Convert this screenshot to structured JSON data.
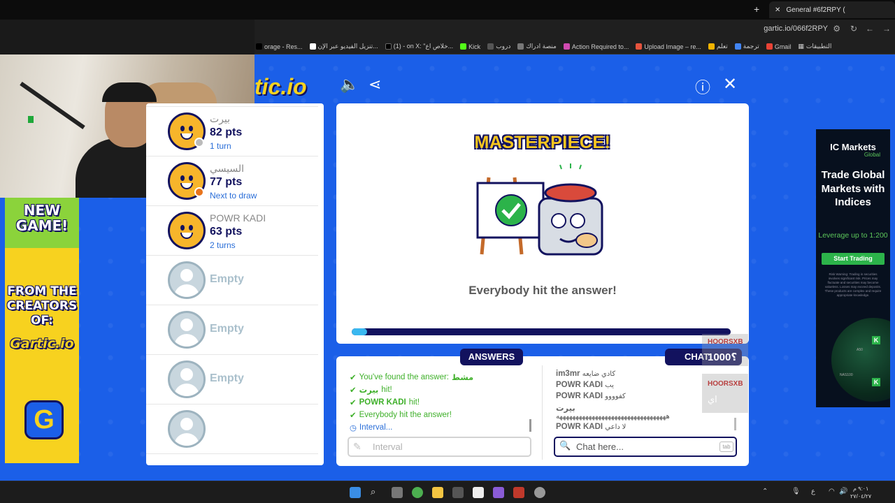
{
  "browser": {
    "tab_title": "General #6f2RPY (",
    "url": "gartic.io/066f2RPY",
    "bookmarks": [
      {
        "label": "Gmail",
        "color": "#ea4335"
      },
      {
        "label": "ترجمة",
        "color": "#4285f4"
      },
      {
        "label": "تعلم",
        "color": "#f4b400"
      },
      {
        "label": "Upload Image – re...",
        "color": "#e5533d"
      },
      {
        "label": "Action Required to...",
        "color": "#d04ab0"
      },
      {
        "label": "منصة ادراك",
        "color": "#777777"
      },
      {
        "label": "دروب",
        "color": "#555555"
      },
      {
        "label": "Kick",
        "color": "#53fc18"
      },
      {
        "label": "(1) - on X: \"خلاص اع...",
        "color": "#000000"
      },
      {
        "label": "تنزيل الفيديو عبر الإن...",
        "color": "#ffffff"
      },
      {
        "label": "orage - Res...",
        "color": "#000000"
      }
    ],
    "apps_label": "التطبيقات"
  },
  "left_ad": {
    "line1": "NEW",
    "line2": "GAME!",
    "line3": "FROM THE",
    "line4": "CREATORS",
    "line5": "OF:",
    "logo": "Gartic.io",
    "g": "G"
  },
  "logo_text": "tic.io",
  "players": [
    {
      "name": "بيرت",
      "points": "82 pts",
      "status": "1 turn",
      "badge_color": "#bbbbbb"
    },
    {
      "name": "السيسي",
      "points": "77 pts",
      "status": "Next to draw",
      "badge_color": "#e8741c"
    },
    {
      "name": "POWR KADI",
      "points": "63 pts",
      "status": "2 turns",
      "badge_color": ""
    }
  ],
  "empty_slot_label": "Empty",
  "main": {
    "headline": "MASTERPIECE!",
    "message": "Everybody hit the answer!",
    "progress": 0.04
  },
  "answers": {
    "tab_label": "ANSWERS",
    "lines": [
      {
        "text": "You've found the answer:",
        "bold": "مشط",
        "kind": "found"
      },
      {
        "text": "hit!",
        "bold": "بيرت",
        "kind": "hit"
      },
      {
        "text": "hit!",
        "bold": "POWR KADI",
        "kind": "hit"
      },
      {
        "text": "Everybody hit the answer!",
        "bold": "",
        "kind": "all"
      },
      {
        "text": "Interval...",
        "bold": "",
        "kind": "interval"
      }
    ],
    "input_placeholder": "Interval"
  },
  "chat": {
    "tab_label": "CHAT",
    "lines": [
      {
        "name": "im3mr",
        "msg": "كادي ضايعه"
      },
      {
        "name": "POWR KADI",
        "msg": "يب"
      },
      {
        "name": "POWR KADI",
        "msg": "كفوووو"
      },
      {
        "name": "بيرت",
        "msg": ""
      },
      {
        "name": "",
        "msg": "ههههههههههههههههههههههههههههههههههه"
      },
      {
        "name": "POWR KADI",
        "msg": "لا داعي"
      }
    ],
    "input_placeholder": "Chat here...",
    "tab_key": "tab"
  },
  "stream_overlay": {
    "user1": "HOORSXB",
    "amount": "1000؟",
    "user2": "HOORSXB",
    "msg2": "اي"
  },
  "right_ad": {
    "brand": "IC Markets",
    "sub": "Global",
    "headline": "Trade Global Markets with Indices",
    "leverage": "Leverage up to 1:200",
    "button": "Start Trading",
    "risk": "Risk Warning: Trading in securities involves significant risk. Prices may fluctuate and securities may become valueless. Losses may exceed deposits. These products are complex and require appropriate knowledge.",
    "market1": "A50",
    "market2": "NAS100"
  },
  "taskbar": {
    "clock_time": "٩:٠١ م",
    "clock_date": "٢٧/٠٤/٢٧",
    "lang": "ع"
  }
}
